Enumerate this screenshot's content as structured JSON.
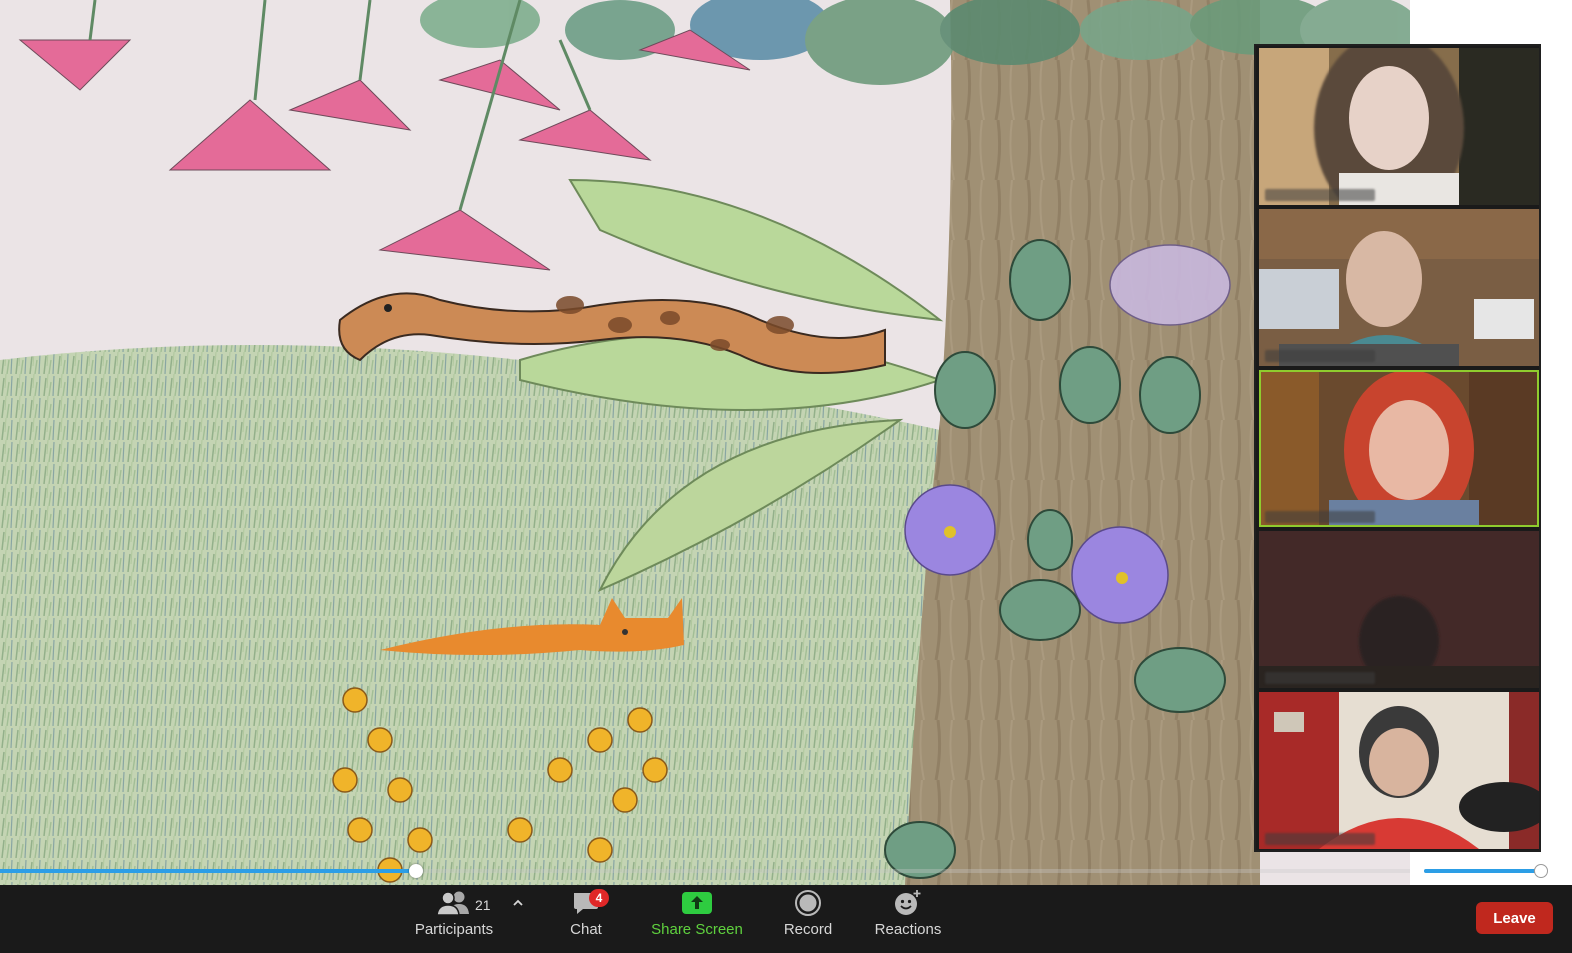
{
  "toolbar": {
    "participants_label": "Participants",
    "participants_count": "21",
    "participants_caret": "^",
    "chat_label": "Chat",
    "chat_badge": "4",
    "share_label": "Share Screen",
    "record_label": "Record",
    "reactions_label": "Reactions",
    "leave_label": "Leave"
  },
  "video_progress": {
    "fraction": 0.295
  },
  "volume": {
    "fraction": 0.94
  },
  "gallery": {
    "tiles": [
      {
        "id": "participant-1",
        "active": false
      },
      {
        "id": "participant-2",
        "active": false
      },
      {
        "id": "participant-3",
        "active": true
      },
      {
        "id": "participant-4",
        "active": false
      },
      {
        "id": "participant-5",
        "active": false
      }
    ]
  },
  "colors": {
    "toolbar_bg": "#1a1a1a",
    "accent_blue": "#2c9ee6",
    "share_green": "#5fd13e",
    "leave_red": "#c0281e",
    "badge_red": "#e02828",
    "active_speaker": "#8fcc2e"
  },
  "icons": {
    "participants": "participants-icon",
    "chat": "chat-icon",
    "share": "share-screen-icon",
    "record": "record-icon",
    "reactions": "reactions-icon"
  }
}
